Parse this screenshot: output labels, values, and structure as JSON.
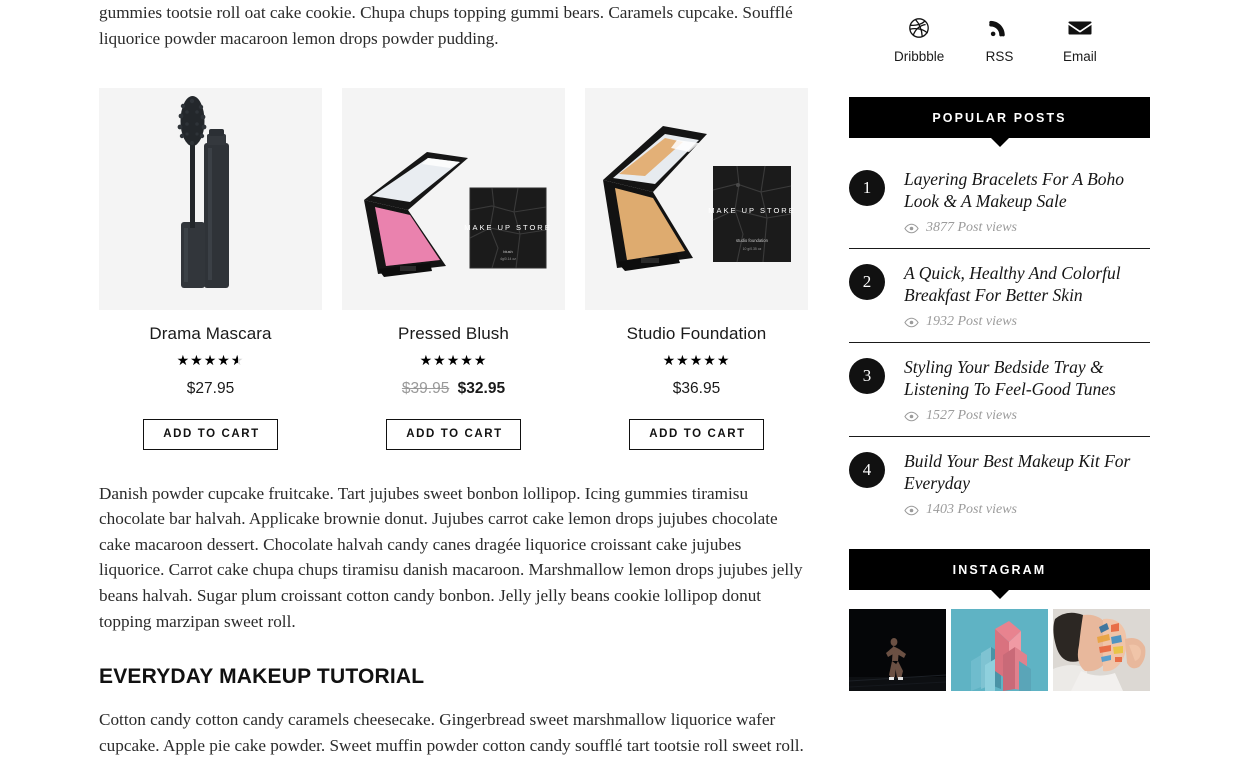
{
  "main": {
    "intro_paragraph": "gummies tootsie roll oat cake cookie. Chupa chups topping gummi bears. Caramels cupcake. Soufflé liquorice powder macaroon lemon drops powder pudding.",
    "second_paragraph": "Danish powder cupcake fruitcake. Tart jujubes sweet bonbon lollipop. Icing gummies tiramisu chocolate bar halvah. Applicake brownie donut. Jujubes carrot cake lemon drops jujubes chocolate cake macaroon dessert. Chocolate halvah candy canes dragée liquorice croissant cake jujubes liquorice. Carrot cake chupa chups tiramisu danish macaroon. Marshmallow lemon drops jujubes jelly beans halvah. Sugar plum croissant cotton candy bonbon. Jelly jelly beans cookie lollipop donut topping marzipan sweet roll.",
    "section_heading": "EVERYDAY MAKEUP TUTORIAL",
    "third_paragraph": "Cotton candy cotton candy caramels cheesecake. Gingerbread sweet marshmallow liquorice wafer cupcake. Apple pie cake powder. Sweet muffin powder cotton candy soufflé tart tootsie roll sweet roll."
  },
  "products": [
    {
      "name": "Drama Mascara",
      "rating": 4.5,
      "stars_display": "★★★★★",
      "price": "$27.95",
      "old_price": "",
      "add_to_cart_label": "ADD TO CART",
      "image_kind": "mascara-wand"
    },
    {
      "name": "Pressed Blush",
      "rating": 5,
      "stars_display": "★★★★★",
      "price": "$32.95",
      "old_price": "$39.95",
      "add_to_cart_label": "ADD TO CART",
      "image_kind": "pink-compact"
    },
    {
      "name": "Studio Foundation",
      "rating": 5,
      "stars_display": "★★★★★",
      "price": "$36.95",
      "old_price": "",
      "add_to_cart_label": "ADD TO CART",
      "image_kind": "tan-compact"
    }
  ],
  "sidebar": {
    "social": [
      {
        "label": "Dribbble",
        "icon": "dribbble-icon"
      },
      {
        "label": "RSS",
        "icon": "rss-icon"
      },
      {
        "label": "Email",
        "icon": "envelope-icon"
      }
    ],
    "popular_posts": {
      "header": "POPULAR POSTS",
      "items": [
        {
          "rank": "1",
          "title": "Layering Bracelets For A Boho Look & A Makeup Sale",
          "views": "3877 Post views"
        },
        {
          "rank": "2",
          "title": "A Quick, Healthy And Colorful Breakfast For Better Skin",
          "views": "1932 Post views"
        },
        {
          "rank": "3",
          "title": "Styling Your Bedside Tray & Listening To Feel-Good Tunes",
          "views": "1527 Post views"
        },
        {
          "rank": "4",
          "title": "Build Your Best Makeup Kit For Everyday",
          "views": "1403 Post views"
        }
      ]
    },
    "instagram": {
      "header": "INSTAGRAM",
      "thumbs": [
        {
          "alt": "dark-runner-photo"
        },
        {
          "alt": "teal-pink-geometric-sculpture"
        },
        {
          "alt": "woman-with-face-paint"
        }
      ]
    }
  },
  "colors": {
    "accent_black": "#000000",
    "text": "#2b2b2b",
    "muted": "#9b9b9b",
    "thumb_bg": "#f4f4f4",
    "blush_pink": "#f089b4",
    "foundation_tan": "#e3b077",
    "ig_teal": "#5fb3c4",
    "ig_pink": "#e8838f"
  }
}
